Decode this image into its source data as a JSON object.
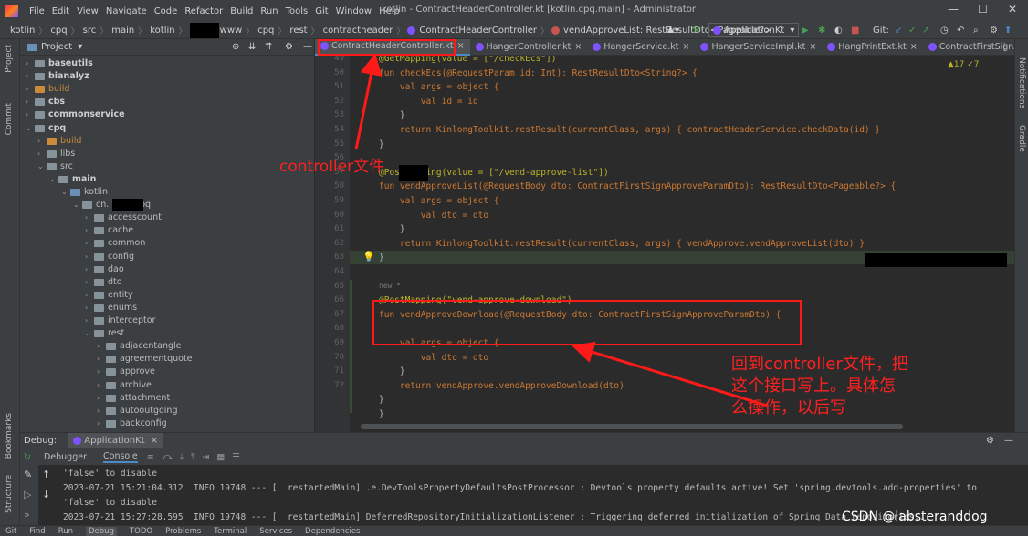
{
  "window": {
    "menu": [
      "File",
      "Edit",
      "View",
      "Navigate",
      "Code",
      "Refactor",
      "Build",
      "Run",
      "Tools",
      "Git",
      "Window",
      "Help"
    ],
    "title": "kotlin - ContractHeaderController.kt [kotlin.cpq.main] - Administrator",
    "controls": [
      "—",
      "☐",
      "✕"
    ]
  },
  "breadcrumb": {
    "items": [
      "kotlin",
      "cpq",
      "src",
      "main",
      "kotlin",
      "www",
      "cpq",
      "rest",
      "contractheader",
      "ContractHeaderController",
      "vendApproveList: RestResultDto<Pageable?>"
    ],
    "run_config": "ApplicationKt",
    "git_label": "Git:"
  },
  "project_panel": {
    "title": "Project",
    "tree": [
      {
        "label": "baseutils",
        "level": 1,
        "style": "bold",
        "expanded": false
      },
      {
        "label": "bianalyz",
        "level": 1,
        "style": "bold",
        "expanded": false
      },
      {
        "label": "build",
        "level": 1,
        "style": "excluded",
        "expanded": false
      },
      {
        "label": "cbs",
        "level": 1,
        "style": "bold",
        "expanded": false
      },
      {
        "label": "commonservice",
        "level": 1,
        "style": "bold",
        "expanded": false
      },
      {
        "label": "cpq",
        "level": 1,
        "style": "bold",
        "expanded": true
      },
      {
        "label": "build",
        "level": 2,
        "style": "excluded",
        "expanded": false
      },
      {
        "label": "libs",
        "level": 2,
        "style": "normal",
        "expanded": false
      },
      {
        "label": "src",
        "level": 2,
        "style": "normal",
        "expanded": true
      },
      {
        "label": "main",
        "level": 3,
        "style": "bold",
        "expanded": true
      },
      {
        "label": "kotlin",
        "level": 4,
        "style": "normal",
        "expanded": true
      },
      {
        "label": "cn.      www.cpq",
        "level": 5,
        "style": "normal",
        "expanded": true
      },
      {
        "label": "accesscount",
        "level": 6,
        "style": "normal",
        "expanded": false
      },
      {
        "label": "cache",
        "level": 6,
        "style": "normal",
        "expanded": false
      },
      {
        "label": "common",
        "level": 6,
        "style": "normal",
        "expanded": false
      },
      {
        "label": "config",
        "level": 6,
        "style": "normal",
        "expanded": false
      },
      {
        "label": "dao",
        "level": 6,
        "style": "normal",
        "expanded": false
      },
      {
        "label": "dto",
        "level": 6,
        "style": "normal",
        "expanded": false
      },
      {
        "label": "entity",
        "level": 6,
        "style": "normal",
        "expanded": false
      },
      {
        "label": "enums",
        "level": 6,
        "style": "normal",
        "expanded": false
      },
      {
        "label": "interceptor",
        "level": 6,
        "style": "normal",
        "expanded": false
      },
      {
        "label": "rest",
        "level": 6,
        "style": "normal",
        "expanded": true
      },
      {
        "label": "adjacentangle",
        "level": 7,
        "style": "normal",
        "expanded": false
      },
      {
        "label": "agreementquote",
        "level": 7,
        "style": "normal",
        "expanded": false
      },
      {
        "label": "approve",
        "level": 7,
        "style": "normal",
        "expanded": false
      },
      {
        "label": "archive",
        "level": 7,
        "style": "normal",
        "expanded": false
      },
      {
        "label": "attachment",
        "level": 7,
        "style": "normal",
        "expanded": false
      },
      {
        "label": "autooutgoing",
        "level": 7,
        "style": "normal",
        "expanded": false
      },
      {
        "label": "backconfig",
        "level": 7,
        "style": "normal",
        "expanded": false
      }
    ]
  },
  "tabs": [
    "ContractHeaderController.kt",
    "HangerController.kt",
    "HangerService.kt",
    "HangerServiceImpl.kt",
    "HangPrintExt.kt",
    "ContractFirstSignApproveC"
  ],
  "editor": {
    "inspection": "▲17  ✓7",
    "line_numbers": [
      "49",
      "50",
      "51",
      "52",
      "53",
      "54",
      "55",
      "56",
      "57",
      "58",
      "59",
      "60",
      "61",
      "62",
      "63",
      "64",
      "65",
      "66",
      "67",
      "68",
      "69",
      "70",
      "71",
      "72"
    ],
    "lines": [
      "@GetMapping(value = [\"/checkEcs\"])",
      "fun checkEcs(@RequestParam id: Int): RestResultDto<String?> {",
      "    val args = object {",
      "        val id = id",
      "    }",
      "    return KinlongToolkit.restResult(currentClass, args) { contractHeaderService.checkData(id) }",
      "}",
      "",
      "@PostMapping(value = [\"/vend-approve-list\"])",
      "fun vendApproveList(@RequestBody dto: ContractFirstSignApproveParamDto): RestResultDto<Pageable?> {",
      "    val args = object {",
      "        val dto = dto",
      "    }",
      "    return KinlongToolkit.restResult(currentClass, args) { vendApprove.vendApproveList(dto) }",
      "}",
      "",
      "new *",
      "@PostMapping(\"vend-approve-download\")",
      "fun vendApproveDownload(@RequestBody dto: ContractFirstSignApproveParamDto) {",
      "",
      "    val args = object {",
      "        val dto = dto",
      "    }",
      "    return vendApprove.vendApproveDownload(dto)",
      "}",
      "}"
    ]
  },
  "annotations": {
    "controller_label": "controller文件",
    "note": [
      "回到controller文件，把",
      "这个接口写上。具体怎",
      "么操作，以后写"
    ]
  },
  "debug": {
    "title": "Debug:",
    "run_tab": "ApplicationKt",
    "subtabs": [
      "Debugger",
      "Console"
    ],
    "console_lines": [
      "'false' to disable",
      "2023-07-21 15:21:04.312  INFO 19748 --- [  restartedMain] .e.DevToolsPropertyDefaultsPostProcessor : Devtools property defaults active! Set 'spring.devtools.add-properties' to",
      "'false' to disable",
      "2023-07-21 15:27:28.595  INFO 19748 --- [  restartedMain] DeferredRepositoryInitializationListener : Triggering deferred initialization of Spring Data repositories..."
    ]
  },
  "statusbar": [
    "Git",
    "Find",
    "Run",
    "Debug",
    "TODO",
    "Problems",
    "Terminal",
    "Services",
    "Dependencies"
  ],
  "side_labels": {
    "left": [
      "Project",
      "Commit",
      "Bookmarks",
      "Structure"
    ],
    "right": [
      "Notifications",
      "Gradle"
    ]
  },
  "watermark": "CSDN @labsteranddog",
  "colors": {
    "accent": "#4a88c7",
    "annotation_red": "#ff1a1a",
    "kotlin_icon": "#7f52ff"
  }
}
